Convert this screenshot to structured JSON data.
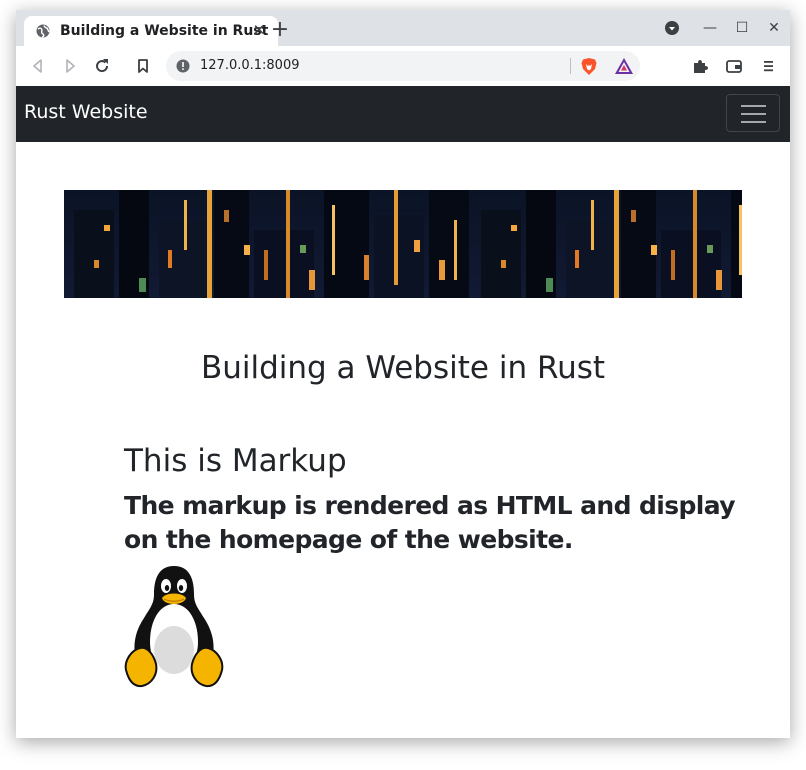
{
  "browser": {
    "tab": {
      "title": "Building a Website in Rust",
      "close_glyph": "✕"
    },
    "new_tab_glyph": "+",
    "window_controls": {
      "minimize": "—",
      "maximize": "☐",
      "close": "✕"
    },
    "address_bar": {
      "url": "127.0.0.1:8009"
    },
    "icons": {
      "back": "back-icon",
      "forward": "forward-icon",
      "reload": "reload-icon",
      "bookmark": "bookmark-icon",
      "site_info": "info-icon",
      "brave_shields": "brave-shields-icon",
      "brave_rewards": "brave-rewards-icon",
      "extensions": "puzzle-icon",
      "wallet": "wallet-icon",
      "menu": "hamburger-menu-icon",
      "profile": "profile-dropdown-icon"
    }
  },
  "site": {
    "navbar": {
      "brand": "Rust Website",
      "background": "#212529",
      "toggler_icon": "hamburger-icon"
    },
    "page_title": "Building a Website in Rust",
    "markup": {
      "heading": "This is Markup",
      "subheading": "The markup is rendered as HTML and display on the homepage of the website.",
      "image": "tux-penguin"
    }
  }
}
